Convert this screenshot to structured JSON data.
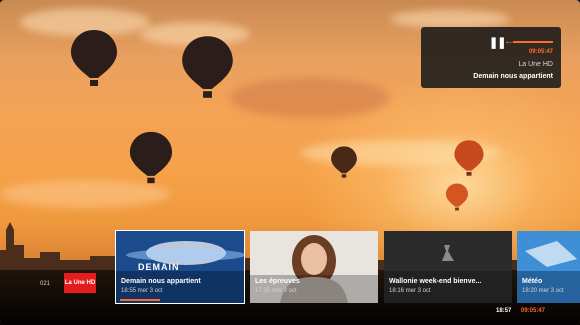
{
  "now_playing": {
    "time": "09:05:47",
    "channel": "La Une HD",
    "title": "Demain nous appartient"
  },
  "channels": {
    "items": [
      "021",
      "La Une HD"
    ],
    "active": "La Une HD"
  },
  "programs": [
    {
      "title": "Demain nous appartient",
      "time": "18:55 mer 3 oct",
      "logo": "DEMAIN"
    },
    {
      "title": "Les épreuves",
      "time": "17:25 mer 3 oct"
    },
    {
      "title": "Wallonie week-end bienve...",
      "time": "18:16 mer 3 oct"
    },
    {
      "title": "Météo",
      "time": "18:20 mer 3 oct"
    }
  ],
  "status": {
    "clock": "18:57",
    "timer": "09:05:47"
  },
  "colors": {
    "accent": "#ff6a2a",
    "channel_highlight": "#e31d1d",
    "panel": "#191919"
  }
}
